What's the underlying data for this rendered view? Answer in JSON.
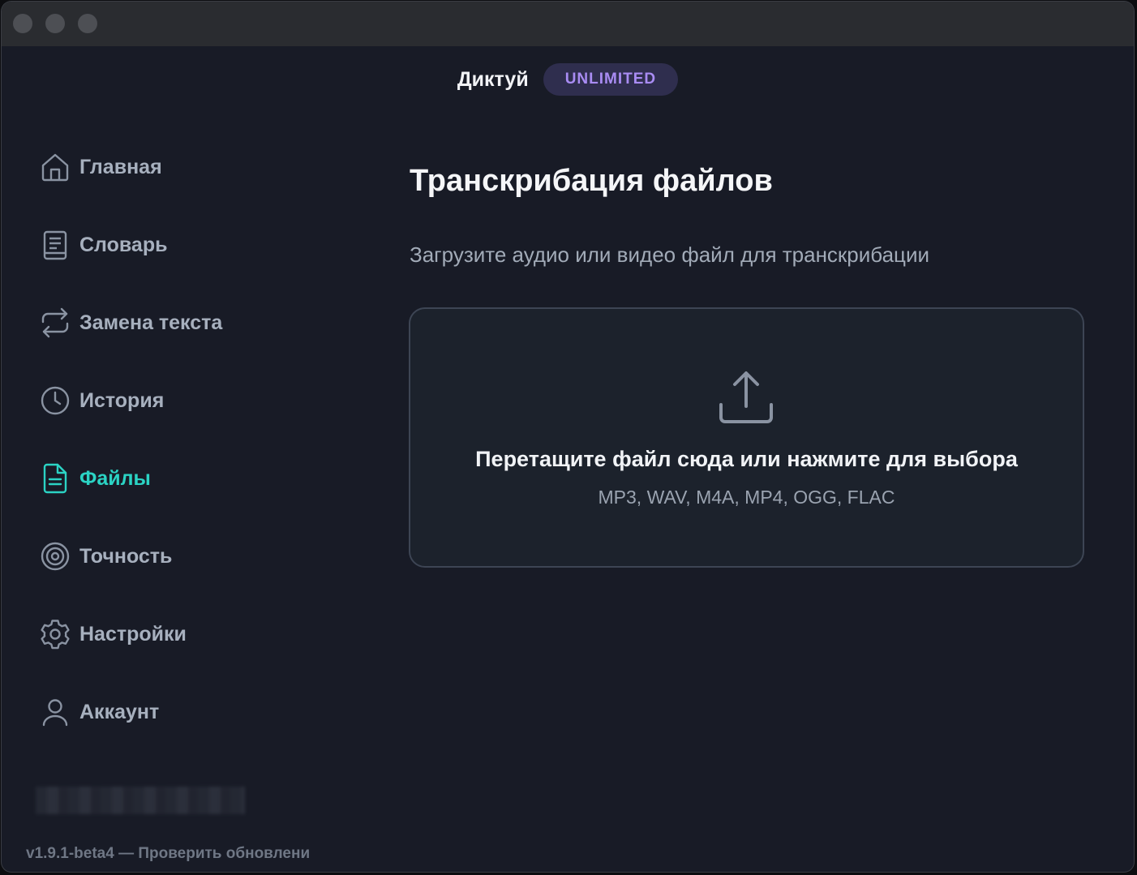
{
  "titlebar": {
    "traffic_lights": [
      "close",
      "minimize",
      "zoom"
    ]
  },
  "header": {
    "app_name": "Диктуй",
    "plan_badge": "UNLIMITED"
  },
  "sidebar": {
    "items": [
      {
        "label": "Главная",
        "icon": "home-icon",
        "active": false
      },
      {
        "label": "Словарь",
        "icon": "book-icon",
        "active": false
      },
      {
        "label": "Замена текста",
        "icon": "repeat-icon",
        "active": false
      },
      {
        "label": "История",
        "icon": "clock-icon",
        "active": false
      },
      {
        "label": "Файлы",
        "icon": "file-icon",
        "active": true
      },
      {
        "label": "Точность",
        "icon": "target-icon",
        "active": false
      },
      {
        "label": "Настройки",
        "icon": "gear-icon",
        "active": false
      },
      {
        "label": "Аккаунт",
        "icon": "user-icon",
        "active": false
      }
    ],
    "version_text": "v1.9.1-beta4 — Проверить обновлени"
  },
  "main": {
    "title": "Транскрибация файлов",
    "subtitle": "Загрузите аудио или видео файл для транскрибации",
    "dropzone": {
      "icon": "upload-icon",
      "title": "Перетащите файл сюда или нажмите для выбора",
      "formats": "MP3, WAV, M4A, MP4, OGG, FLAC"
    }
  },
  "colors": {
    "background": "#181b26",
    "titlebar": "#2a2c30",
    "accent_active": "#2bd3c4",
    "badge_bg": "#2f2e4e",
    "badge_text": "#a98cf3",
    "nav_text": "#a7b0be"
  }
}
